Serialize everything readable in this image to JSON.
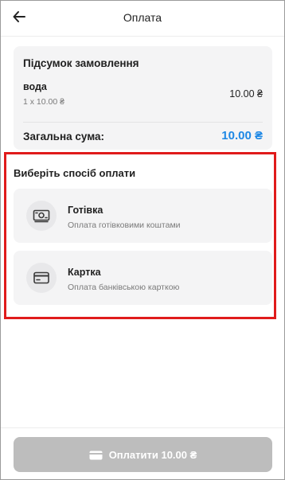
{
  "header": {
    "title": "Оплата",
    "back_icon": "arrow-left-icon"
  },
  "summary": {
    "title": "Підсумок замовлення",
    "items": [
      {
        "name": "вода",
        "qty_line": "1 x 10.00 ₴",
        "price": "10.00 ₴"
      }
    ],
    "total_label": "Загальна сума:",
    "total_value": "10.00 ₴",
    "accent_color": "#1e88e5"
  },
  "payment": {
    "title": "Виберіть спосіб оплати",
    "highlight_color": "#e01b1b",
    "methods": [
      {
        "icon": "cash-icon",
        "title": "Готівка",
        "subtitle": "Оплата готівковими коштами"
      },
      {
        "icon": "credit-card-icon",
        "title": "Картка",
        "subtitle": "Оплата банківською карткою"
      }
    ]
  },
  "pay_button": {
    "label": "Оплатити 10.00 ₴",
    "icon": "credit-card-icon",
    "disabled": true,
    "color": "#bdbdbd"
  }
}
